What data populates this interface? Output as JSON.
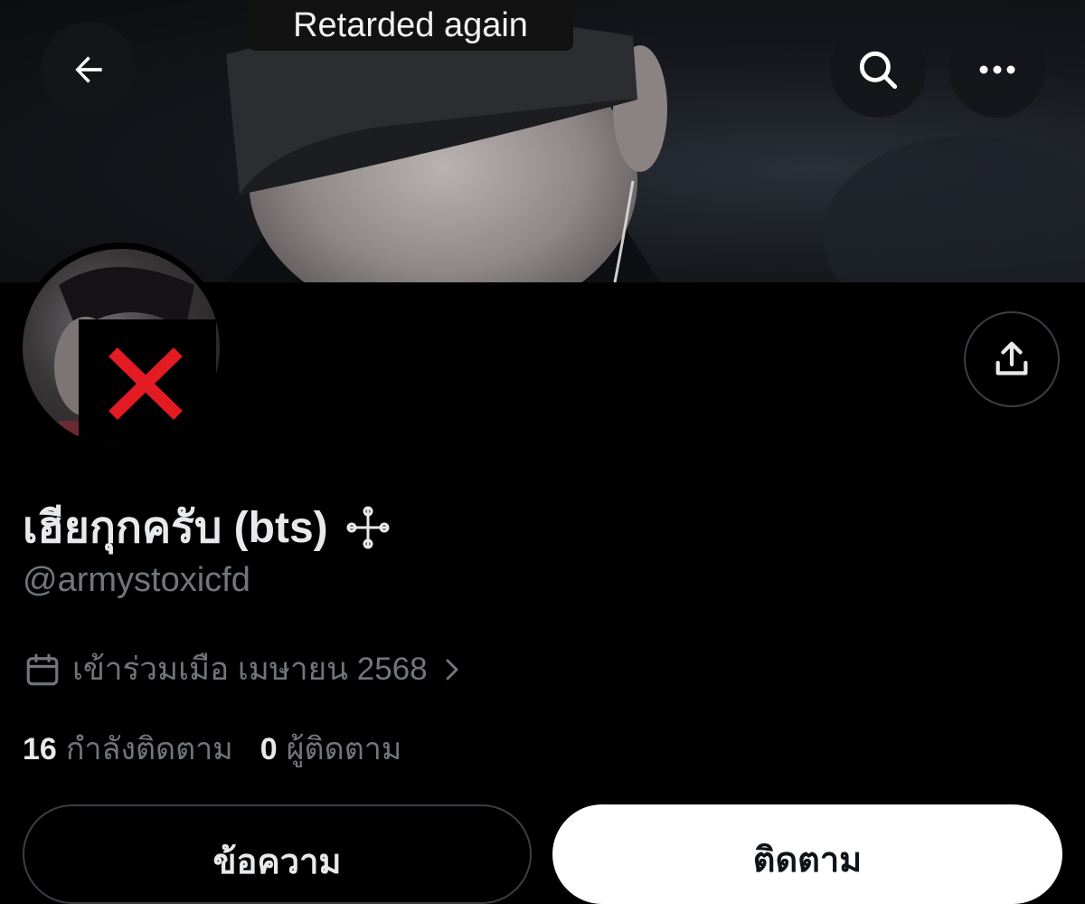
{
  "banner": {
    "caption": "Retarded again",
    "back_icon": "arrow-left-icon",
    "search_icon": "search-icon",
    "more_icon": "more-horizontal-icon"
  },
  "profile": {
    "display_name": "เฮียกุกครับ (bts)",
    "handle": "@armystoxicfd",
    "badge_icon": "sparkle-cross-icon",
    "share_icon": "share-upload-icon",
    "avatar_censor_icon": "red-x-icon",
    "joined": {
      "icon": "calendar-icon",
      "text": "เข้าร่วมเมือ เมษายน 2568",
      "chevron_icon": "chevron-right-icon"
    },
    "stats": {
      "following_count": "16",
      "following_label": "กำลังติดตาม",
      "followers_count": "0",
      "followers_label": "ผู้ติดตาม"
    }
  },
  "actions": {
    "message_label": "ข้อความ",
    "follow_label": "ติดตาม"
  },
  "colors": {
    "background": "#000000",
    "primary_text": "#e7e9ea",
    "secondary_text": "#71767b",
    "border": "#3b3f44",
    "censor_x": "#e31b23",
    "follow_button_bg": "#ffffff"
  }
}
